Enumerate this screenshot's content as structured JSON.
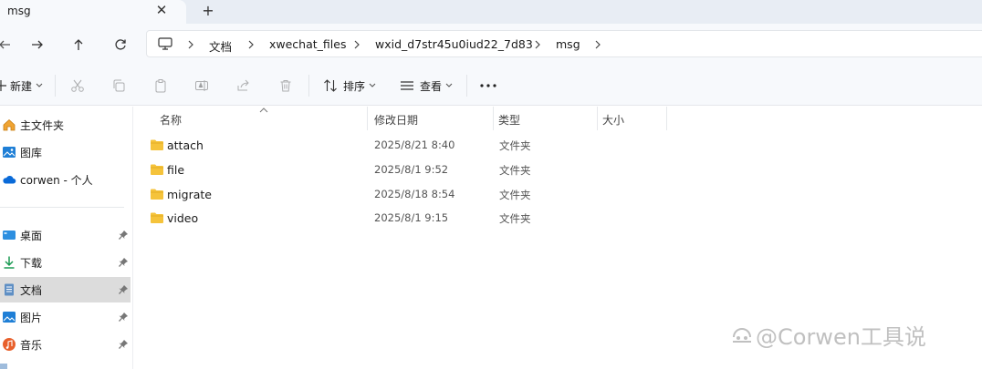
{
  "tab": {
    "title": "msg",
    "close": "✕",
    "new": "+"
  },
  "breadcrumb": [
    "文档",
    "xwechat_files",
    "wxid_d7str45u0iud22_7d83",
    "msg"
  ],
  "toolbar": {
    "new_label": "新建",
    "sort_label": "排序",
    "view_label": "查看",
    "more": "···"
  },
  "sidebar": {
    "items": [
      {
        "label": "主文件夹",
        "icon": "home-icon"
      },
      {
        "label": "图库",
        "icon": "gallery-icon"
      },
      {
        "label": "corwen - 个人",
        "icon": "cloud-icon"
      },
      {
        "label": "桌面",
        "icon": "desktop-icon",
        "pinned": true
      },
      {
        "label": "下载",
        "icon": "download-icon",
        "pinned": true
      },
      {
        "label": "文档",
        "icon": "document-icon",
        "pinned": true,
        "selected": true
      },
      {
        "label": "图片",
        "icon": "pictures-icon",
        "pinned": true
      },
      {
        "label": "音乐",
        "icon": "music-icon",
        "pinned": true
      }
    ]
  },
  "columns": {
    "name": "名称",
    "date": "修改日期",
    "type": "类型",
    "size": "大小"
  },
  "files": [
    {
      "name": "attach",
      "date": "2025/8/21 8:40",
      "type": "文件夹"
    },
    {
      "name": "file",
      "date": "2025/8/1 9:52",
      "type": "文件夹"
    },
    {
      "name": "migrate",
      "date": "2025/8/18 8:54",
      "type": "文件夹"
    },
    {
      "name": "video",
      "date": "2025/8/1 9:15",
      "type": "文件夹"
    }
  ],
  "watermark": "@Corwen工具说",
  "colors": {
    "folder": "#f5c33b",
    "accent": "#0067c0",
    "selected_bg": "#dcdcdc"
  }
}
